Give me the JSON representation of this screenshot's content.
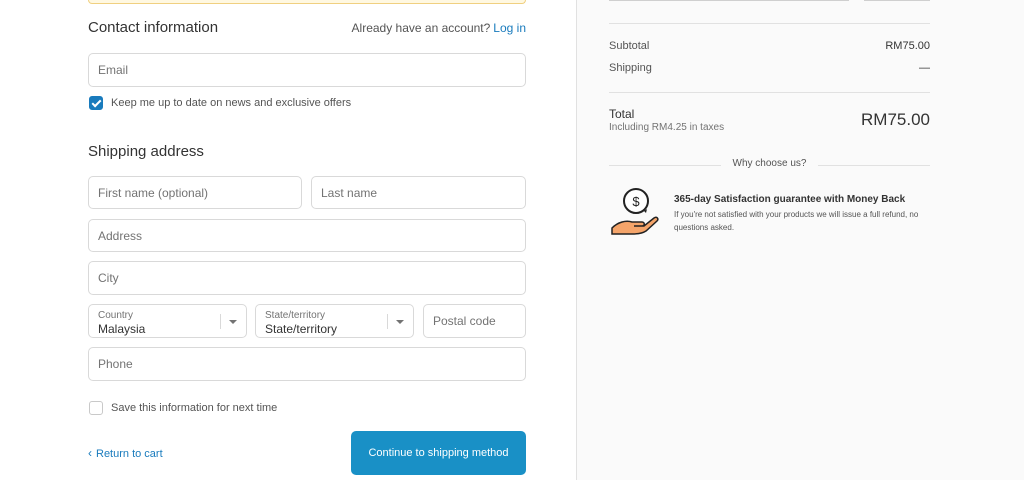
{
  "contact": {
    "title": "Contact information",
    "account_prompt": "Already have an account?",
    "login_link": "Log in",
    "email_placeholder": "Email",
    "newsletter_label": "Keep me up to date on news and exclusive offers"
  },
  "shipping": {
    "title": "Shipping address",
    "first_name_placeholder": "First name (optional)",
    "last_name_placeholder": "Last name",
    "address_placeholder": "Address",
    "city_placeholder": "City",
    "country_label": "Country",
    "country_value": "Malaysia",
    "state_label": "State/territory",
    "state_value": "State/territory",
    "postal_placeholder": "Postal code",
    "phone_placeholder": "Phone",
    "save_info_label": "Save this information for next time"
  },
  "actions": {
    "return_label": "Return to cart",
    "continue_label": "Continue to shipping method"
  },
  "summary": {
    "subtotal_label": "Subtotal",
    "subtotal_value": "RM75.00",
    "shipping_label": "Shipping",
    "shipping_value": "—",
    "total_label": "Total",
    "tax_note": "Including RM4.25 in taxes",
    "total_value": "RM75.00",
    "why_label": "Why choose us?",
    "guarantee_title": "365-day Satisfaction guarantee with Money Back",
    "guarantee_body": "If you're not satisfied with your products we will issue a full refund, no questions asked."
  },
  "colors": {
    "accent": "#197bbd",
    "button": "#1990c6"
  },
  "icons": {
    "chevron": "chevron-left-icon",
    "guarantee": "money-back-hand-icon",
    "select_arrow": "chevron-down-icon",
    "checkmark": "checkmark-icon"
  }
}
